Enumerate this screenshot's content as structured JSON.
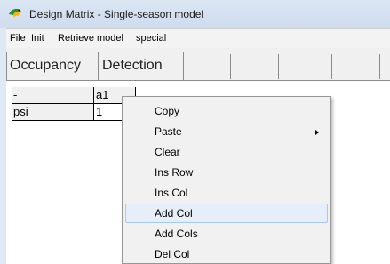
{
  "window": {
    "title": "Design Matrix - Single-season model"
  },
  "menubar": {
    "items": [
      {
        "label": "File"
      },
      {
        "label": "Init"
      },
      {
        "label": "Retrieve model"
      },
      {
        "label": "special"
      }
    ]
  },
  "tabs": [
    {
      "label": "Occupancy"
    },
    {
      "label": "Detection"
    }
  ],
  "grid": {
    "header_row": [
      "-",
      "a1"
    ],
    "rows": [
      [
        "psi",
        "1"
      ]
    ]
  },
  "context_menu": {
    "items": [
      {
        "label": "Copy"
      },
      {
        "label": "Paste",
        "submenu": true
      },
      {
        "label": "Clear"
      },
      {
        "label": "Ins Row"
      },
      {
        "label": "Ins Col"
      },
      {
        "label": "Add Col",
        "highlighted": true
      },
      {
        "label": "Add Cols"
      },
      {
        "label": "Del Col"
      }
    ]
  },
  "colors": {
    "titlebar": "#d5e1f0",
    "menu_hover_fill": "#e5eef9",
    "menu_hover_border": "#aac6ec"
  }
}
